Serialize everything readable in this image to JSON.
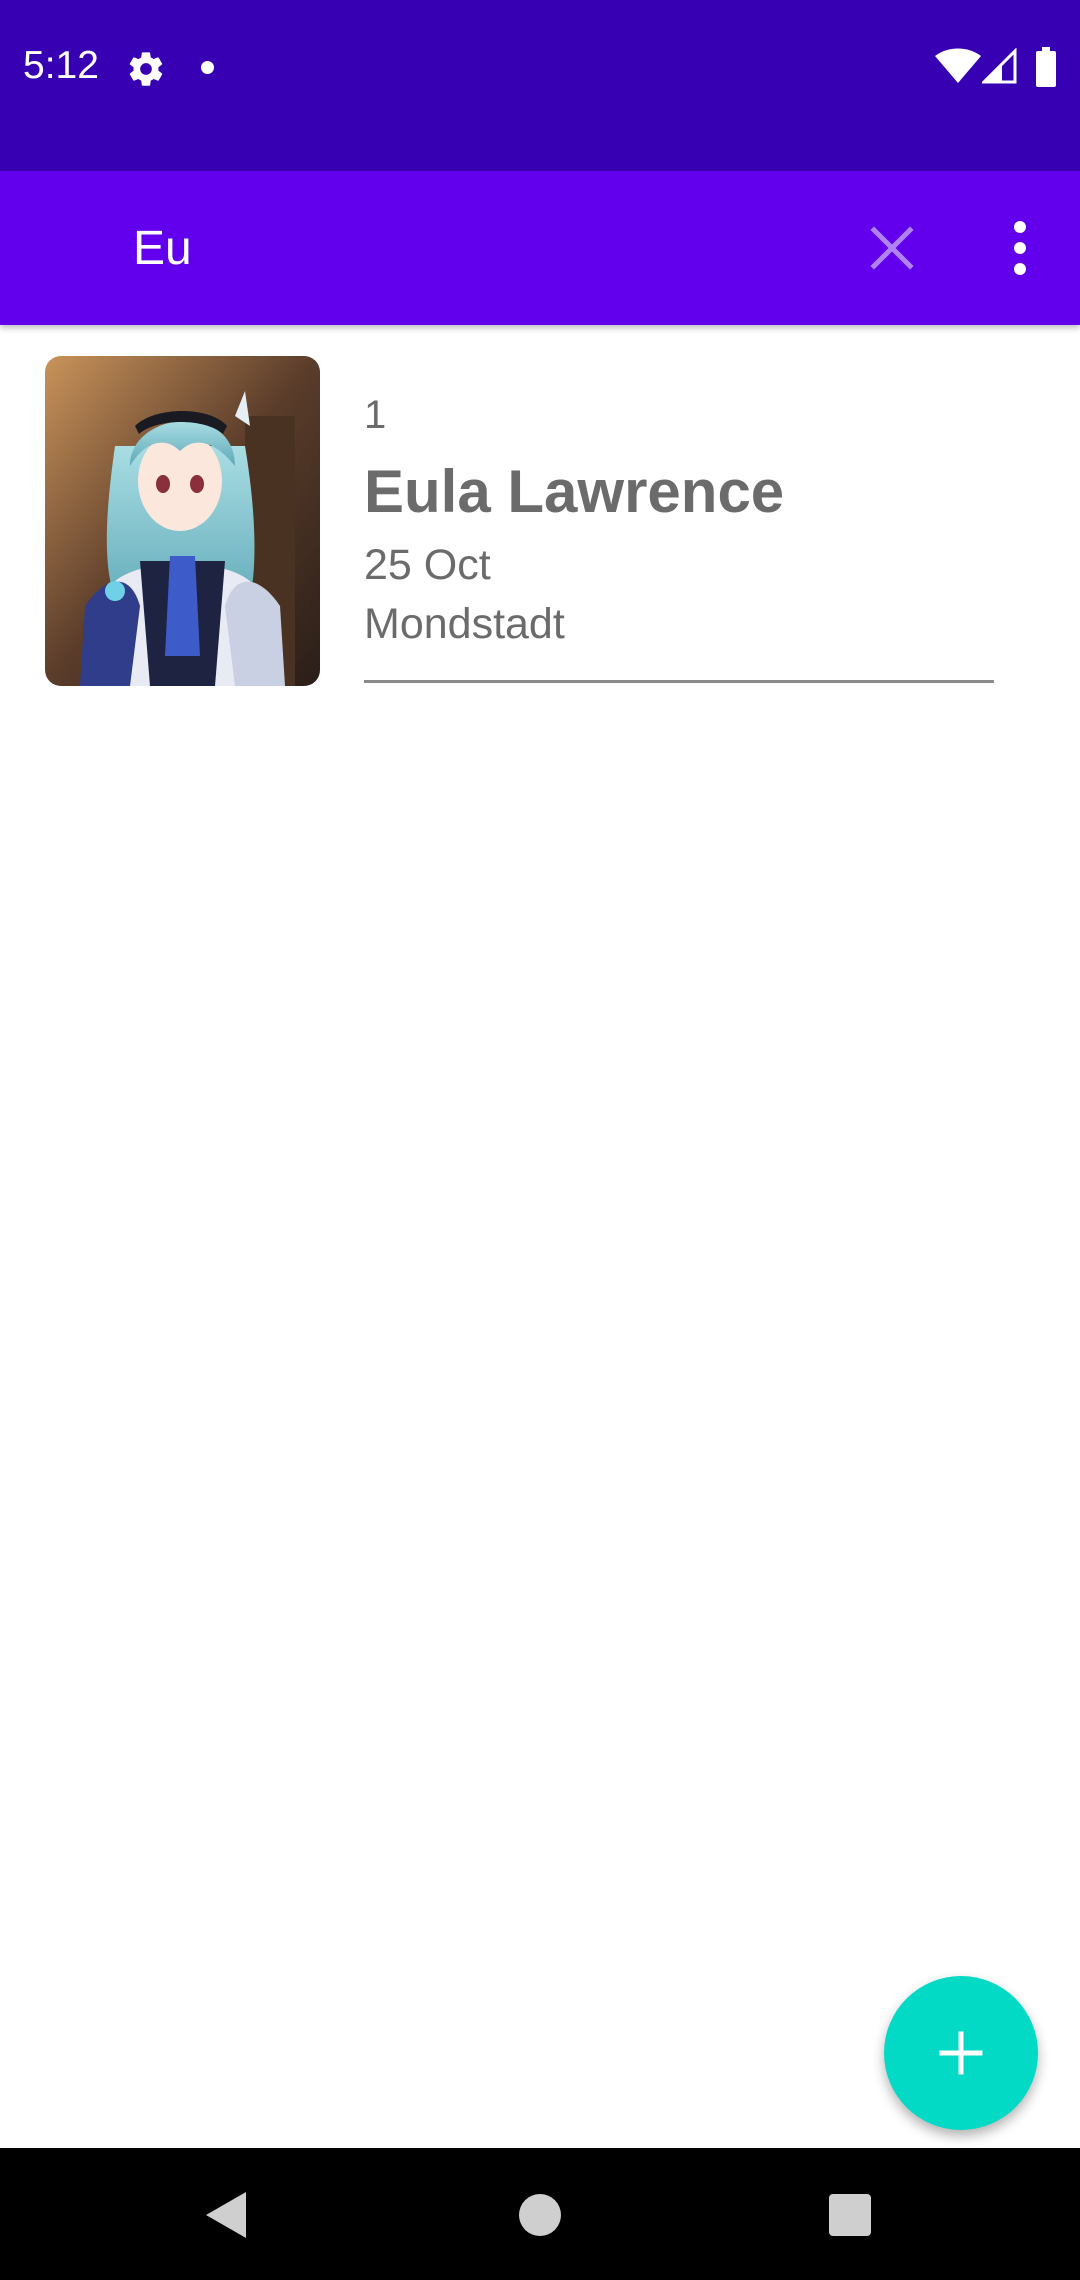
{
  "status_bar": {
    "time": "5:12",
    "icons": [
      "gear-icon",
      "notification-dot-icon",
      "wifi-icon",
      "signal-icon",
      "battery-icon"
    ]
  },
  "app_bar": {
    "search_value": "Eu",
    "clear_icon": "close-icon",
    "more_icon": "more-vert-icon",
    "color": "#6200ee"
  },
  "results": [
    {
      "number": "1",
      "name": "Eula Lawrence",
      "date": "25 Oct",
      "region": "Mondstadt"
    }
  ],
  "fab": {
    "icon": "plus-icon",
    "color": "#03dac5"
  },
  "nav_bar": {
    "icons": [
      "back-icon",
      "home-icon",
      "recents-icon"
    ]
  },
  "colors": {
    "status_bar": "#3700b3",
    "app_bar": "#6200ee",
    "accent": "#03dac5",
    "text_secondary": "#6b6b6b"
  }
}
